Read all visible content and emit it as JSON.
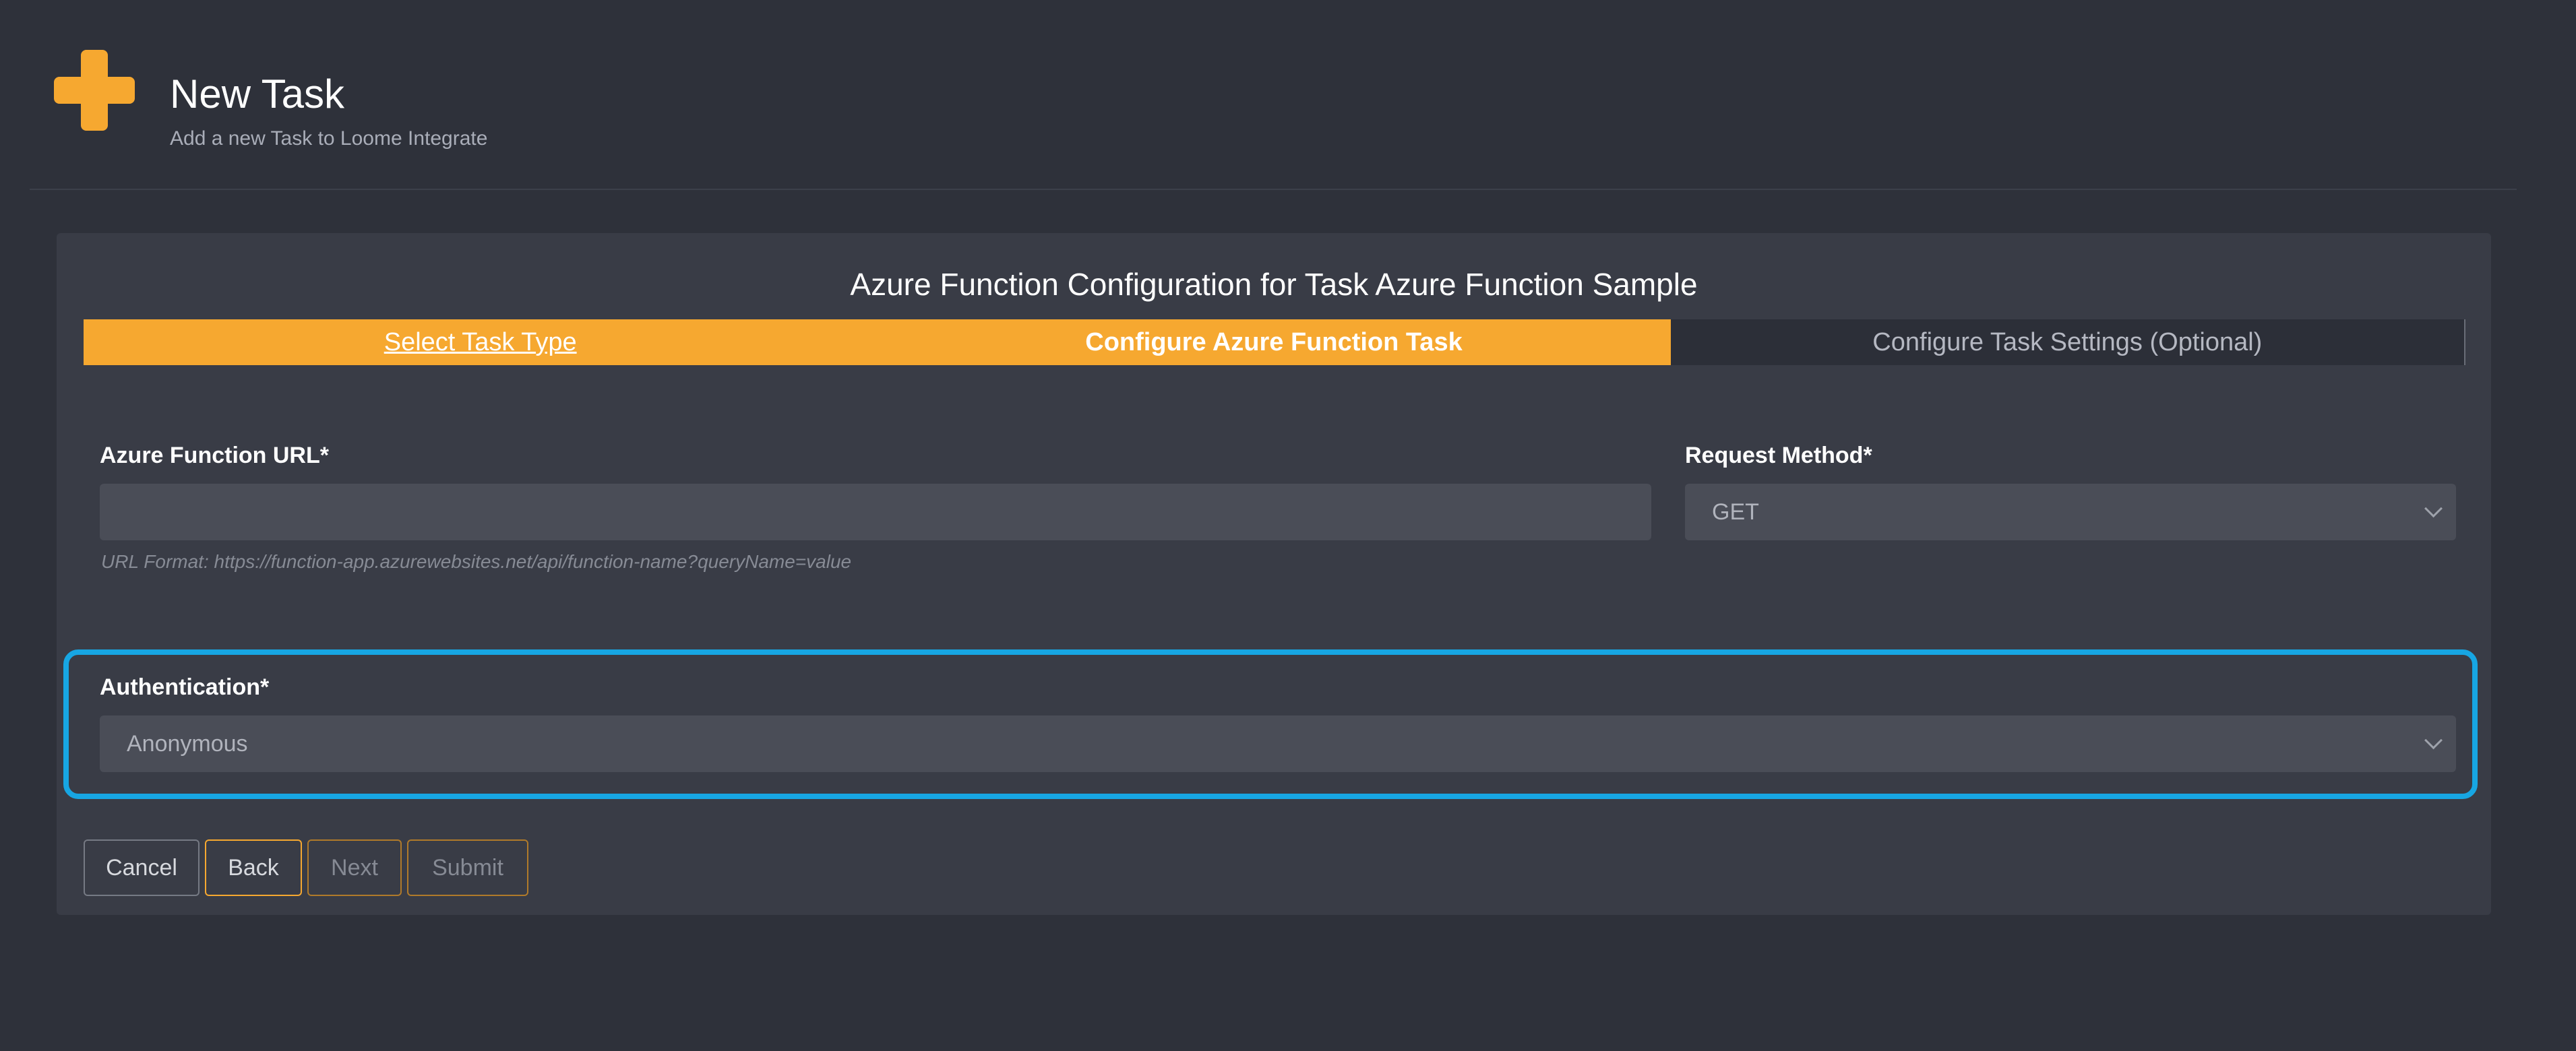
{
  "header": {
    "icon": "plus-icon",
    "title": "New Task",
    "subtitle": "Add a new Task to Loome Integrate"
  },
  "card": {
    "title": "Azure Function Configuration for Task Azure Function Sample"
  },
  "steps": [
    {
      "label": "Select Task Type",
      "state": "completed"
    },
    {
      "label": "Configure Azure Function Task",
      "state": "active"
    },
    {
      "label": "Configure Task Settings (Optional)",
      "state": "pending"
    }
  ],
  "form": {
    "url": {
      "label": "Azure Function URL*",
      "value": "",
      "hint": "URL Format: https://function-app.azurewebsites.net/api/function-name?queryName=value"
    },
    "method": {
      "label": "Request Method*",
      "value": "GET"
    },
    "auth": {
      "label": "Authentication*",
      "value": "Anonymous"
    }
  },
  "buttons": {
    "cancel": "Cancel",
    "back": "Back",
    "next": "Next",
    "submit": "Submit"
  },
  "colors": {
    "accent": "#f6a830",
    "highlight": "#17a6e3",
    "background": "#2e313a",
    "card": "#393c46"
  }
}
